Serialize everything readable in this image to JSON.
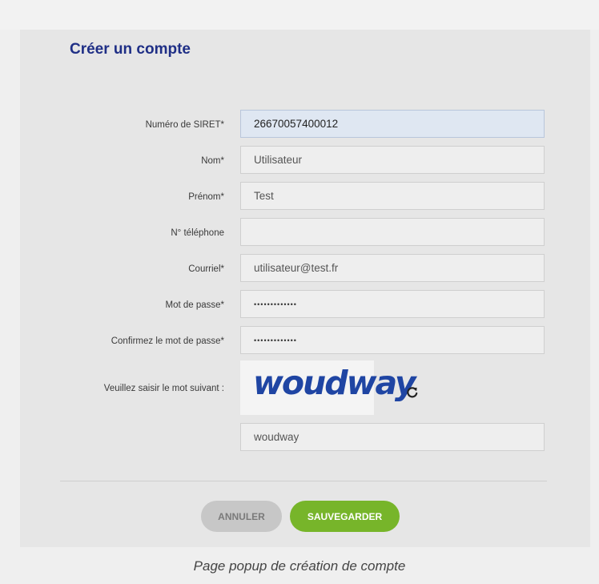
{
  "form": {
    "title": "Créer un compte",
    "fields": [
      {
        "label": "Numéro de SIRET*",
        "value": "26670057400012"
      },
      {
        "label": "Nom*",
        "value": "Utilisateur"
      },
      {
        "label": "Prénom*",
        "value": "Test"
      },
      {
        "label": "N° téléphone",
        "value": ""
      },
      {
        "label": "Courriel*",
        "value": "utilisateur@test.fr"
      },
      {
        "label": "Mot de passe*",
        "value": "•••••••••••••"
      },
      {
        "label": "Confirmez le mot de passe*",
        "value": "•••••••••••••"
      }
    ],
    "captcha": {
      "label": "Veuillez saisir le mot suivant :",
      "word": "woudway",
      "input_value": "woudway"
    },
    "buttons": {
      "cancel": "ANNULER",
      "save": "SAUVEGARDER"
    }
  },
  "caption": "Page popup de création de compte",
  "colors": {
    "title": "#1f2f86",
    "save_button": "#77b52a",
    "cancel_button": "#c7c7c7",
    "captcha": "#1f45a3"
  },
  "icons": {
    "refresh": "refresh-icon"
  }
}
